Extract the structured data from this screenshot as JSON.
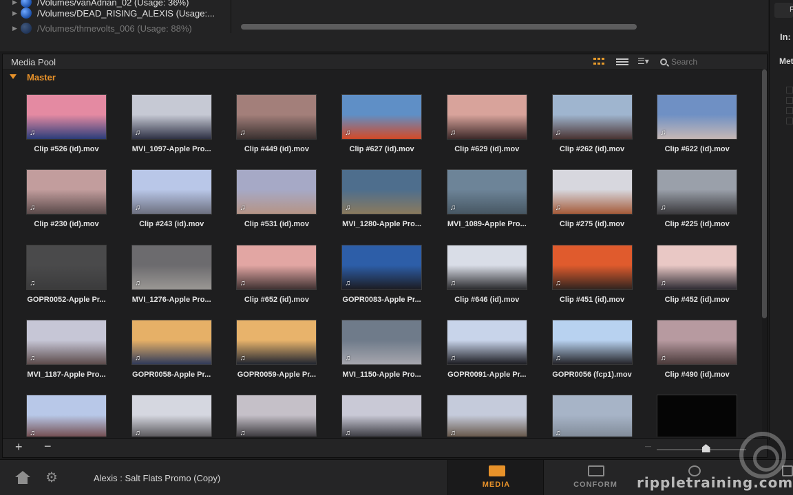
{
  "volumes": {
    "rows": [
      {
        "path": "/Volumes/vanAdrian_02 (Usage: 36%)"
      },
      {
        "path": "/Volumes/DEAD_RISING_ALEXIS (Usage:..."
      },
      {
        "path": "/Volumes/thmevolts_006 (Usage: 88%)"
      }
    ]
  },
  "right_panel": {
    "in_label": "In:",
    "meta_label": "Met",
    "top_button": "F"
  },
  "media_pool": {
    "title": "Media Pool",
    "search_placeholder": "Search",
    "sort_icon_text": "☰▾",
    "bin": "Master",
    "clips": [
      {
        "name": "Clip #526 (id).mov",
        "colors": [
          "#e48aa2",
          "#2c3d7a"
        ]
      },
      {
        "name": "MVI_1097-Apple Pro...",
        "colors": [
          "#c6c9d4",
          "#2f3245"
        ]
      },
      {
        "name": "Clip #449 (id).mov",
        "colors": [
          "#a37f7a",
          "#3a3130"
        ]
      },
      {
        "name": "Clip #627 (id).mov",
        "colors": [
          "#5f8fc6",
          "#d34a28"
        ]
      },
      {
        "name": "Clip #629 (id).mov",
        "colors": [
          "#d8a39b",
          "#3e2a2a"
        ]
      },
      {
        "name": "Clip #262 (id).mov",
        "colors": [
          "#9fb5cf",
          "#4a3433"
        ]
      },
      {
        "name": "Clip #622 (id).mov",
        "colors": [
          "#6f90c4",
          "#c6b8b6"
        ]
      },
      {
        "name": "Clip #230 (id).mov",
        "colors": [
          "#c29d9d",
          "#5a4a4a"
        ]
      },
      {
        "name": "Clip #243 (id).mov",
        "colors": [
          "#b9c7e8",
          "#6d7080"
        ]
      },
      {
        "name": "Clip #531 (id).mov",
        "colors": [
          "#a6a9c6",
          "#b59486"
        ]
      },
      {
        "name": "MVI_1280-Apple Pro...",
        "colors": [
          "#4e6e8d",
          "#8a7a5e"
        ]
      },
      {
        "name": "MVI_1089-Apple Pro...",
        "colors": [
          "#6d8498",
          "#475763"
        ]
      },
      {
        "name": "Clip #275 (id).mov",
        "colors": [
          "#d7d7de",
          "#a55b3a"
        ]
      },
      {
        "name": "Clip #225 (id).mov",
        "colors": [
          "#9aa0aa",
          "#3b3a3d"
        ]
      },
      {
        "name": "GOPR0052-Apple Pr...",
        "colors": [
          "#4a4a4b",
          "#3b3b3c"
        ]
      },
      {
        "name": "MVI_1276-Apple Pro...",
        "colors": [
          "#6c6b6e",
          "#9a9794"
        ]
      },
      {
        "name": "Clip #652 (id).mov",
        "colors": [
          "#e2a6a3",
          "#3f3131"
        ]
      },
      {
        "name": "GOPR0083-Apple Pr...",
        "colors": [
          "#2d5ea8",
          "#1c1c22"
        ]
      },
      {
        "name": "Clip #646 (id).mov",
        "colors": [
          "#d9dde7",
          "#2a2a2d"
        ]
      },
      {
        "name": "Clip #451 (id).mov",
        "colors": [
          "#e05b2d",
          "#30241f"
        ]
      },
      {
        "name": "Clip #452 (id).mov",
        "colors": [
          "#e9c8c5",
          "#2e2b33"
        ]
      },
      {
        "name": "MVI_1187-Apple Pro...",
        "colors": [
          "#c6c6d6",
          "#5b4a4a"
        ]
      },
      {
        "name": "GOPR0058-Apple Pr...",
        "colors": [
          "#e6b067",
          "#2f3a5a"
        ]
      },
      {
        "name": "GOPR0059-Apple Pr...",
        "colors": [
          "#e8b36b",
          "#1f2430"
        ]
      },
      {
        "name": "MVI_1150-Apple Pro...",
        "colors": [
          "#6f7b8a",
          "#a6a6ad"
        ]
      },
      {
        "name": "GOPR0091-Apple Pr...",
        "colors": [
          "#c8d4ea",
          "#1c1c22"
        ]
      },
      {
        "name": "GOPR0056 (fcp1).mov",
        "colors": [
          "#b8d2f0",
          "#232328"
        ]
      },
      {
        "name": "Clip #490 (id).mov",
        "colors": [
          "#b79aa0",
          "#4a3a3a"
        ]
      },
      {
        "name": "",
        "colors": [
          "#b8c8e8",
          "#6b4040"
        ]
      },
      {
        "name": "",
        "colors": [
          "#d5d7e0",
          "#4c4a4d"
        ]
      },
      {
        "name": "",
        "colors": [
          "#c5c0c8",
          "#2c2a2e"
        ]
      },
      {
        "name": "",
        "colors": [
          "#c9c9d6",
          "#2c2c32"
        ]
      },
      {
        "name": "",
        "colors": [
          "#c5cbdb",
          "#5b4a3a"
        ]
      },
      {
        "name": "",
        "colors": [
          "#a7b4c7",
          "#7d8794"
        ]
      },
      {
        "name": "",
        "colors": [
          "#050505",
          "#050505"
        ]
      }
    ],
    "add_label": "+",
    "remove_label": "−",
    "zoom_min_label": "—",
    "thumb_zoom_level": 0.55
  },
  "bottom_bar": {
    "project_name": "Alexis : Salt Flats Promo (Copy)",
    "tabs": {
      "media": "MEDIA",
      "conform": "CONFORM",
      "color": ""
    },
    "gear_glyph": "⚙"
  },
  "watermark": "rippletraining.com",
  "colors": {
    "accent": "#e8922a",
    "background": "#1b1b1c"
  },
  "music_note": "♫"
}
